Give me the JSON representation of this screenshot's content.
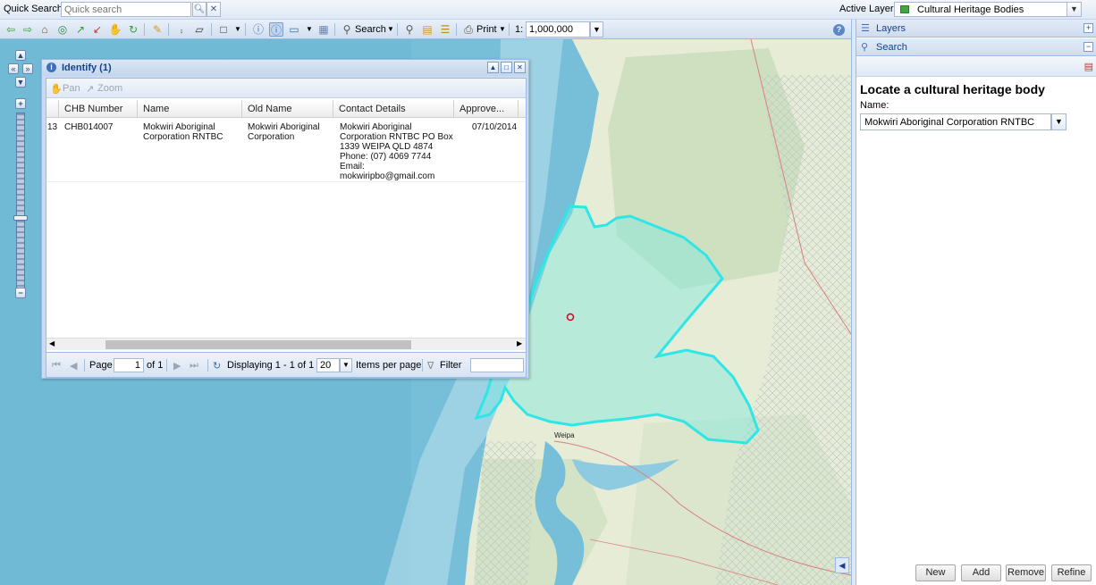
{
  "quick_search": {
    "label": "Quick Search:",
    "placeholder": "Quick search",
    "go_icon": "search-icon",
    "clear_icon": "close-icon"
  },
  "active_layer": {
    "label": "Active Layer:",
    "value": "Cultural Heritage Bodies",
    "swatch_color": "#46a346"
  },
  "toolbar": {
    "search_label": "Search",
    "print_label": "Print",
    "scale_label": "1:",
    "scale_value": "1,000,000"
  },
  "identify": {
    "title": "Identify (1)",
    "pan_label": "Pan",
    "zoom_label": "Zoom",
    "columns": [
      "CHB Number",
      "Name",
      "Old Name",
      "Contact Details",
      "Approve..."
    ],
    "rows": [
      {
        "index": "13",
        "chb_number": "CHB014007",
        "name_l1": "Mokwiri Aboriginal",
        "name_l2": "Corporation RNTBC",
        "old_name_l1": "Mokwiri Aboriginal",
        "old_name_l2": "Corporation",
        "contact_l1": "Mokwiri Aboriginal",
        "contact_l2": "Corporation RNTBC PO Box",
        "contact_l3": "1339 WEIPA QLD 4874",
        "contact_l4": "Phone: (07) 4069 7744",
        "contact_l5": "Email:",
        "contact_l6": "mokwiripbo@gmail.com",
        "approved": "07/10/2014"
      }
    ],
    "pager": {
      "page_label": "Page",
      "page_value": "1",
      "of_label": "of 1",
      "displaying": "Displaying 1 - 1 of 1",
      "per_page_value": "20",
      "per_page_label": "Items per page",
      "filter_label": "Filter"
    }
  },
  "right_panel": {
    "layers_label": "Layers",
    "search_label": "Search",
    "locate_title": "Locate a cultural heritage body",
    "name_label": "Name:",
    "name_value": "Mokwiri Aboriginal Corporation RNTBC",
    "buttons": {
      "new": "New",
      "add": "Add",
      "remove": "Remove",
      "refine": "Refine"
    }
  },
  "map": {
    "ocean_color": "#77bfd9",
    "highlight_color": "#2fe6e6",
    "labels": {
      "weipa": "Weipa"
    }
  }
}
